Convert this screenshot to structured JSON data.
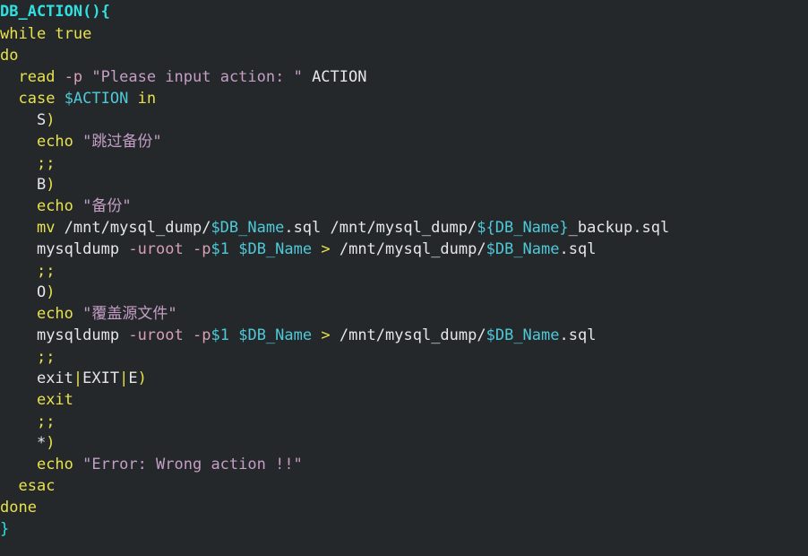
{
  "editor": {
    "background_color": "#24282b",
    "language": "bash",
    "colors": {
      "function_name": "#30e0e0",
      "keyword": "#e8e24a",
      "variable": "#4ec9d8",
      "string": "#c49ec4",
      "plain_text": "#e6e6e6",
      "option_flag": "#d8a0b4",
      "operator": "#e8e24a"
    }
  },
  "code": {
    "full_text": "DB_ACTION(){\nwhile true\ndo\n  read -p \"Please input action: \" ACTION\n  case $ACTION in\n    S)\n    echo \"跳过备份\"\n    ;;\n    B)\n    echo \"备份\"\n    mv /mnt/mysql_dump/$DB_Name.sql /mnt/mysql_dump/${DB_Name}_backup.sql\n    mysqldump -uroot -p$1 $DB_Name > /mnt/mysql_dump/$DB_Name.sql\n    ;;\n    O)\n    echo \"覆盖源文件\"\n    mysqldump -uroot -p$1 $DB_Name > /mnt/mysql_dump/$DB_Name.sql\n    ;;\n    exit|EXIT|E)\n    exit\n    ;;\n    *)\n    echo \"Error: Wrong action !!\"\n  esac\ndone\n}",
    "lines": [
      {
        "n": 1,
        "text": "DB_ACTION(){",
        "tokens": [
          {
            "t": "DB_ACTION(){",
            "c": "tok-func"
          }
        ]
      },
      {
        "n": 2,
        "text": "while true",
        "tokens": [
          {
            "t": "while true",
            "c": "tok-keyword"
          }
        ]
      },
      {
        "n": 3,
        "text": "do",
        "tokens": [
          {
            "t": "do",
            "c": "tok-keyword"
          }
        ]
      },
      {
        "n": 4,
        "text": "  read -p \"Please input action: \" ACTION",
        "tokens": [
          {
            "t": "  ",
            "c": "tok-plain"
          },
          {
            "t": "read",
            "c": "tok-builtin"
          },
          {
            "t": " ",
            "c": "tok-plain"
          },
          {
            "t": "-p",
            "c": "tok-option"
          },
          {
            "t": " ",
            "c": "tok-plain"
          },
          {
            "t": "\"Please input action: \"",
            "c": "tok-string"
          },
          {
            "t": " ACTION",
            "c": "tok-plain"
          }
        ]
      },
      {
        "n": 5,
        "text": "  case $ACTION in",
        "tokens": [
          {
            "t": "  ",
            "c": "tok-plain"
          },
          {
            "t": "case",
            "c": "tok-keyword"
          },
          {
            "t": " ",
            "c": "tok-plain"
          },
          {
            "t": "$ACTION",
            "c": "tok-var"
          },
          {
            "t": " ",
            "c": "tok-plain"
          },
          {
            "t": "in",
            "c": "tok-keyword"
          }
        ]
      },
      {
        "n": 6,
        "text": "    S)",
        "tokens": [
          {
            "t": "    ",
            "c": "tok-plain"
          },
          {
            "t": "S",
            "c": "tok-plain"
          },
          {
            "t": ")",
            "c": "tok-punct"
          }
        ]
      },
      {
        "n": 7,
        "text": "    echo \"跳过备份\"",
        "tokens": [
          {
            "t": "    ",
            "c": "tok-plain"
          },
          {
            "t": "echo",
            "c": "tok-builtin"
          },
          {
            "t": " ",
            "c": "tok-plain"
          },
          {
            "t": "\"跳过备份\"",
            "c": "tok-string"
          }
        ]
      },
      {
        "n": 8,
        "text": "    ;;",
        "tokens": [
          {
            "t": "    ",
            "c": "tok-plain"
          },
          {
            "t": ";;",
            "c": "tok-punct"
          }
        ]
      },
      {
        "n": 9,
        "text": "    B)",
        "tokens": [
          {
            "t": "    ",
            "c": "tok-plain"
          },
          {
            "t": "B",
            "c": "tok-plain"
          },
          {
            "t": ")",
            "c": "tok-punct"
          }
        ]
      },
      {
        "n": 10,
        "text": "    echo \"备份\"",
        "tokens": [
          {
            "t": "    ",
            "c": "tok-plain"
          },
          {
            "t": "echo",
            "c": "tok-builtin"
          },
          {
            "t": " ",
            "c": "tok-plain"
          },
          {
            "t": "\"备份\"",
            "c": "tok-string"
          }
        ]
      },
      {
        "n": 11,
        "text": "    mv /mnt/mysql_dump/$DB_Name.sql /mnt/mysql_dump/${DB_Name}_backup.sql",
        "tokens": [
          {
            "t": "    ",
            "c": "tok-plain"
          },
          {
            "t": "mv",
            "c": "tok-builtin"
          },
          {
            "t": " /mnt/mysql_dump/",
            "c": "tok-plain"
          },
          {
            "t": "$DB_Name",
            "c": "tok-var"
          },
          {
            "t": ".sql /mnt/mysql_dump/",
            "c": "tok-plain"
          },
          {
            "t": "${DB_Name}",
            "c": "tok-var"
          },
          {
            "t": "_backup.sql",
            "c": "tok-plain"
          }
        ]
      },
      {
        "n": 12,
        "text": "    mysqldump -uroot -p$1 $DB_Name > /mnt/mysql_dump/$DB_Name.sql",
        "tokens": [
          {
            "t": "    ",
            "c": "tok-plain"
          },
          {
            "t": "mysqldump",
            "c": "tok-plain"
          },
          {
            "t": " ",
            "c": "tok-plain"
          },
          {
            "t": "-uroot",
            "c": "tok-option"
          },
          {
            "t": " ",
            "c": "tok-plain"
          },
          {
            "t": "-p",
            "c": "tok-option"
          },
          {
            "t": "$1",
            "c": "tok-var"
          },
          {
            "t": " ",
            "c": "tok-plain"
          },
          {
            "t": "$DB_Name",
            "c": "tok-var"
          },
          {
            "t": " ",
            "c": "tok-plain"
          },
          {
            "t": ">",
            "c": "tok-op"
          },
          {
            "t": " /mnt/mysql_dump/",
            "c": "tok-plain"
          },
          {
            "t": "$DB_Name",
            "c": "tok-var"
          },
          {
            "t": ".sql",
            "c": "tok-plain"
          }
        ]
      },
      {
        "n": 13,
        "text": "    ;;",
        "tokens": [
          {
            "t": "    ",
            "c": "tok-plain"
          },
          {
            "t": ";;",
            "c": "tok-punct"
          }
        ]
      },
      {
        "n": 14,
        "text": "    O)",
        "tokens": [
          {
            "t": "    ",
            "c": "tok-plain"
          },
          {
            "t": "O",
            "c": "tok-plain"
          },
          {
            "t": ")",
            "c": "tok-punct"
          }
        ]
      },
      {
        "n": 15,
        "text": "    echo \"覆盖源文件\"",
        "tokens": [
          {
            "t": "    ",
            "c": "tok-plain"
          },
          {
            "t": "echo",
            "c": "tok-builtin"
          },
          {
            "t": " ",
            "c": "tok-plain"
          },
          {
            "t": "\"覆盖源文件\"",
            "c": "tok-string"
          }
        ]
      },
      {
        "n": 16,
        "text": "    mysqldump -uroot -p$1 $DB_Name > /mnt/mysql_dump/$DB_Name.sql",
        "tokens": [
          {
            "t": "    ",
            "c": "tok-plain"
          },
          {
            "t": "mysqldump",
            "c": "tok-plain"
          },
          {
            "t": " ",
            "c": "tok-plain"
          },
          {
            "t": "-uroot",
            "c": "tok-option"
          },
          {
            "t": " ",
            "c": "tok-plain"
          },
          {
            "t": "-p",
            "c": "tok-option"
          },
          {
            "t": "$1",
            "c": "tok-var"
          },
          {
            "t": " ",
            "c": "tok-plain"
          },
          {
            "t": "$DB_Name",
            "c": "tok-var"
          },
          {
            "t": " ",
            "c": "tok-plain"
          },
          {
            "t": ">",
            "c": "tok-op"
          },
          {
            "t": " /mnt/mysql_dump/",
            "c": "tok-plain"
          },
          {
            "t": "$DB_Name",
            "c": "tok-var"
          },
          {
            "t": ".sql",
            "c": "tok-plain"
          }
        ]
      },
      {
        "n": 17,
        "text": "    ;;",
        "tokens": [
          {
            "t": "    ",
            "c": "tok-plain"
          },
          {
            "t": ";;",
            "c": "tok-punct"
          }
        ]
      },
      {
        "n": 18,
        "text": "    exit|EXIT|E)",
        "tokens": [
          {
            "t": "    ",
            "c": "tok-plain"
          },
          {
            "t": "exit",
            "c": "tok-plain"
          },
          {
            "t": "|",
            "c": "tok-punct"
          },
          {
            "t": "EXIT",
            "c": "tok-plain"
          },
          {
            "t": "|",
            "c": "tok-punct"
          },
          {
            "t": "E",
            "c": "tok-plain"
          },
          {
            "t": ")",
            "c": "tok-punct"
          }
        ]
      },
      {
        "n": 19,
        "text": "    exit",
        "tokens": [
          {
            "t": "    ",
            "c": "tok-plain"
          },
          {
            "t": "exit",
            "c": "tok-builtin"
          }
        ]
      },
      {
        "n": 20,
        "text": "    ;;",
        "tokens": [
          {
            "t": "    ",
            "c": "tok-plain"
          },
          {
            "t": ";;",
            "c": "tok-punct"
          }
        ]
      },
      {
        "n": 21,
        "text": "    *)",
        "tokens": [
          {
            "t": "    ",
            "c": "tok-plain"
          },
          {
            "t": "*",
            "c": "tok-plain"
          },
          {
            "t": ")",
            "c": "tok-punct"
          }
        ]
      },
      {
        "n": 22,
        "text": "    echo \"Error: Wrong action !!\"",
        "tokens": [
          {
            "t": "    ",
            "c": "tok-plain"
          },
          {
            "t": "echo",
            "c": "tok-builtin"
          },
          {
            "t": " ",
            "c": "tok-plain"
          },
          {
            "t": "\"Error: Wrong action !!\"",
            "c": "tok-string"
          }
        ]
      },
      {
        "n": 23,
        "text": "  esac",
        "tokens": [
          {
            "t": "  ",
            "c": "tok-plain"
          },
          {
            "t": "esac",
            "c": "tok-keyword"
          }
        ]
      },
      {
        "n": 24,
        "text": "done",
        "tokens": [
          {
            "t": "done",
            "c": "tok-keyword"
          }
        ]
      },
      {
        "n": 25,
        "text": "}",
        "tokens": [
          {
            "t": "}",
            "c": "tok-brace"
          }
        ]
      }
    ]
  }
}
